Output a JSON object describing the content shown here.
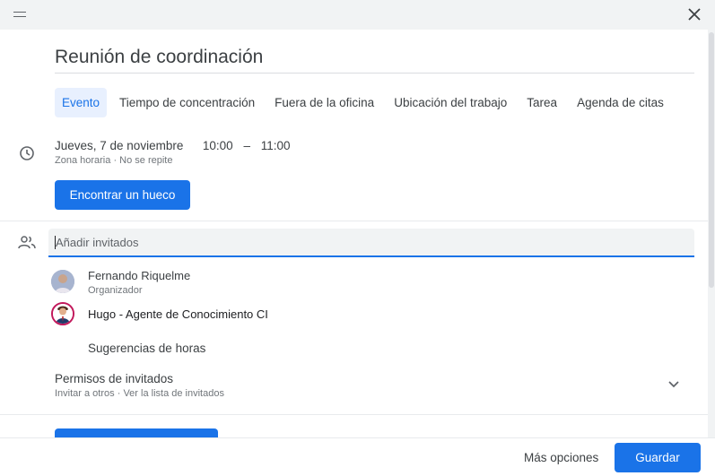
{
  "event": {
    "title": "Reunión de coordinación"
  },
  "tabs": [
    {
      "label": "Evento",
      "active": true
    },
    {
      "label": "Tiempo de concentración",
      "active": false
    },
    {
      "label": "Fuera de la oficina",
      "active": false
    },
    {
      "label": "Ubicación del trabajo",
      "active": false
    },
    {
      "label": "Tarea",
      "active": false
    },
    {
      "label": "Agenda de citas",
      "active": false
    }
  ],
  "schedule": {
    "date": "Jueves, 7 de noviembre",
    "start_time": "10:00",
    "dash": "–",
    "end_time": "11:00",
    "timezone_label": "Zona horaria",
    "dot": "·",
    "recurrence": "No se repite",
    "find_slot_label": "Encontrar un hueco"
  },
  "guests": {
    "placeholder": "Añadir invitados",
    "list": [
      {
        "name": "Fernando Riquelme",
        "role": "Organizador"
      },
      {
        "name": "Hugo - Agente de Conocimiento CI",
        "role": ""
      }
    ],
    "suggestions_label": "Sugerencias de horas"
  },
  "permissions": {
    "title": "Permisos de invitados",
    "invite_others": "Invitar a otros",
    "dot": "·",
    "see_list": "Ver la lista de invitados"
  },
  "footer": {
    "more_options_label": "Más opciones",
    "save_label": "Guardar"
  },
  "icons": {
    "close": "close-icon",
    "drag": "drag-handle-icon",
    "clock": "clock-icon",
    "people": "people-icon",
    "chevron": "chevron-down-icon"
  },
  "colors": {
    "accent": "#1a73e8",
    "tab_active_bg": "#e8f0fe",
    "topbar_bg": "#f1f3f4",
    "avatar2_ring": "#c2185b"
  }
}
